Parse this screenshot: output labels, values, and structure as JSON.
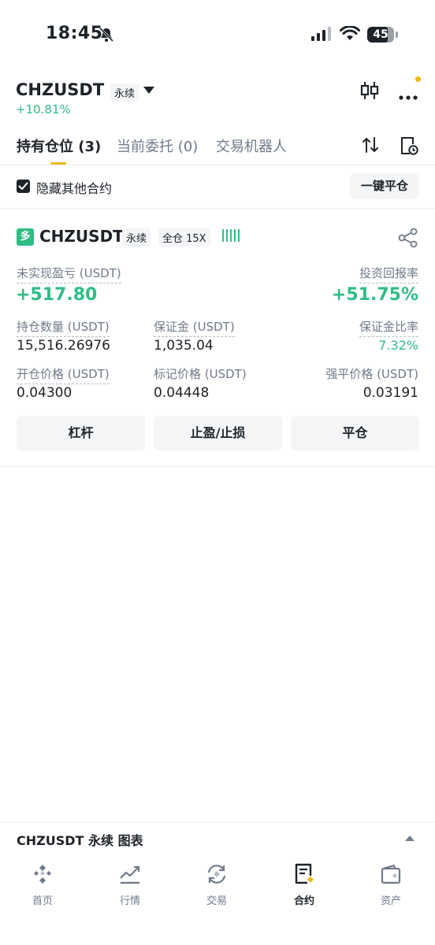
{
  "status_bar": {
    "time": "18:45",
    "battery": "45",
    "icons": [
      "bell-muted-icon",
      "signal-icon",
      "wifi-icon",
      "battery-icon"
    ]
  },
  "header": {
    "symbol": "CHZUSDT",
    "contract_type": "永续",
    "change": "+10.81%",
    "change_color": "#2ebd85",
    "icons": [
      "candlestick-icon",
      "more-icon",
      "chevron-down-icon"
    ]
  },
  "tabs": [
    {
      "label": "持有仓位 (3)",
      "active": true
    },
    {
      "label": "当前委托 (0)",
      "active": false
    },
    {
      "label": "交易机器人",
      "active": false
    }
  ],
  "toolbar_icons": [
    "sort-arrows-icon",
    "history-clock-icon"
  ],
  "filter": {
    "hide_others_label": "隐藏其他合约",
    "hide_others_checked": true,
    "close_all_label": "一键平仓"
  },
  "position": {
    "side_badge": "多",
    "symbol": "CHZUSDT",
    "contract_type": "永续",
    "margin_mode": "全仓 15X",
    "unrealized_pnl_label": "未实现盈亏 (USDT)",
    "unrealized_pnl": "+517.80",
    "roi_label": "投资回报率",
    "roi": "+51.75%",
    "size_label": "持仓数量 (USDT)",
    "size": "15,516.26976",
    "margin_label": "保证金 (USDT)",
    "margin": "1,035.04",
    "margin_ratio_label": "保证金比率",
    "margin_ratio": "7.32%",
    "entry_price_label": "开仓价格 (USDT)",
    "entry_price": "0.04300",
    "mark_price_label": "标记价格 (USDT)",
    "mark_price": "0.04448",
    "liq_price_label": "强平价格 (USDT)",
    "liq_price": "0.03191",
    "buttons": {
      "leverage": "杠杆",
      "tp_sl": "止盈/止损",
      "close": "平仓"
    },
    "accent_green": "#2ebd85"
  },
  "chart_bar": {
    "label": "CHZUSDT 永续 图表"
  },
  "bottom_nav": [
    {
      "label": "首页",
      "icon": "home-diamond-icon",
      "active": false
    },
    {
      "label": "行情",
      "icon": "markets-chart-icon",
      "active": false
    },
    {
      "label": "交易",
      "icon": "trade-exchange-icon",
      "active": false
    },
    {
      "label": "合约",
      "icon": "futures-doc-icon",
      "active": true
    },
    {
      "label": "资产",
      "icon": "wallet-icon",
      "active": false
    }
  ],
  "brand_yellow": "#f0b90b"
}
